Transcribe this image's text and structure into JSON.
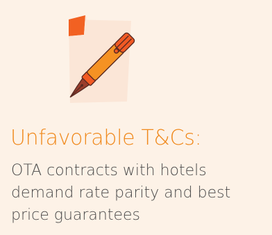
{
  "illustration": {
    "icon": "fountain-pen-document-icon",
    "colors": {
      "page": "#fbe6d7",
      "page_corner": "#f26122",
      "pen_body": "#f59223",
      "pen_cap": "#f15a24",
      "pen_nib": "#9b3d2c",
      "pen_outline": "#5a2a22"
    }
  },
  "card": {
    "title": "Unfavorable T&Cs:",
    "description": "OTA contracts with hotels demand rate parity and best price guarantees"
  },
  "colors": {
    "background": "#fdf2e7",
    "title": "#f08a1e",
    "text": "#4a4a4a"
  }
}
